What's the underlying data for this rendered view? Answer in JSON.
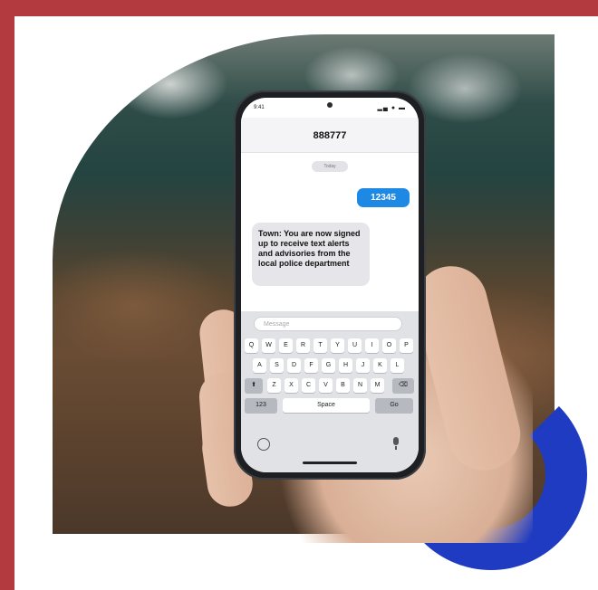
{
  "phone": {
    "status_time": "9:41",
    "status_icons": "▂▄ ● ▬",
    "contact_number": "888777"
  },
  "conversation": {
    "date_label": "Today",
    "sent_message": "12345",
    "received_message": "Town: You are now signed up to receive text alerts and advisories from the local police department"
  },
  "keyboard": {
    "input_placeholder": "Message",
    "row1": [
      "Q",
      "W",
      "E",
      "R",
      "T",
      "Y",
      "U",
      "I",
      "O",
      "P"
    ],
    "row2": [
      "A",
      "S",
      "D",
      "F",
      "G",
      "H",
      "J",
      "K",
      "L"
    ],
    "row3": [
      "⬆",
      "Z",
      "X",
      "C",
      "V",
      "B",
      "N",
      "M",
      "⌫"
    ],
    "row4": {
      "numbers": "123",
      "space": "Space",
      "go": "Go"
    }
  },
  "colors": {
    "frame_red": "#b33a3e",
    "accent_blue": "#1f3bc2",
    "bubble_blue": "#1e88e5",
    "bubble_gray": "#e6e6ea"
  }
}
